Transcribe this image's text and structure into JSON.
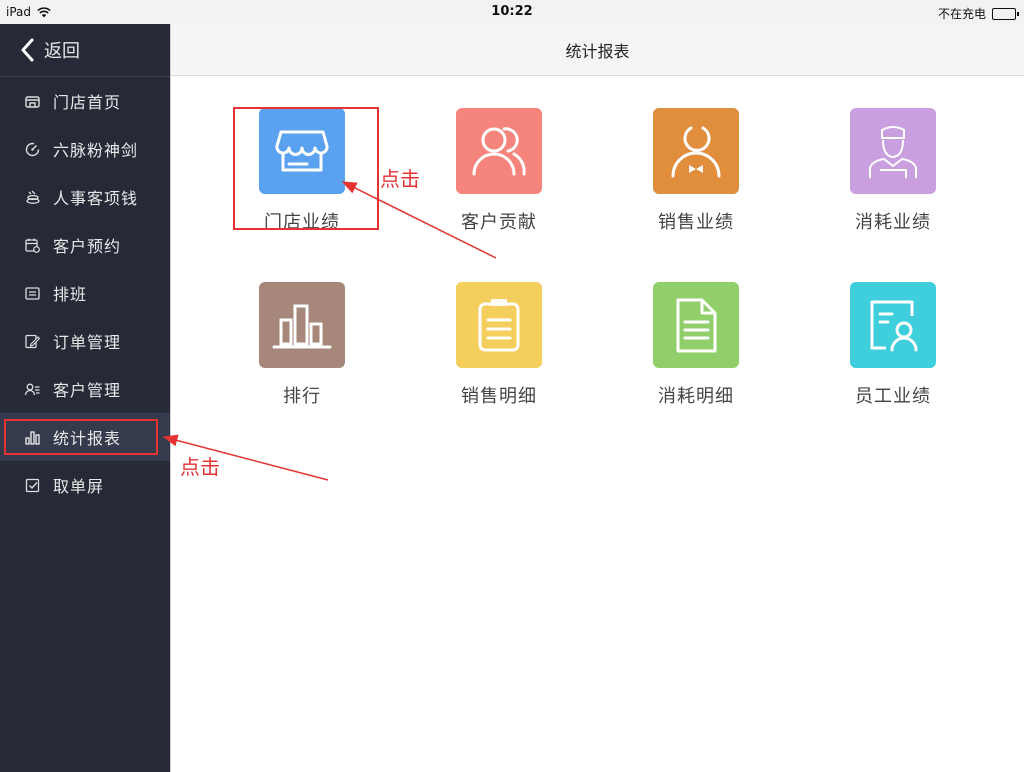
{
  "statusbar": {
    "device": "iPad",
    "time": "10:22",
    "battery": "不在充电"
  },
  "sidebar": {
    "back_label": "返回",
    "items": [
      {
        "label": "门店首页",
        "icon": "store-icon"
      },
      {
        "label": "六脉粉神剑",
        "icon": "gauge-icon"
      },
      {
        "label": "人事客项钱",
        "icon": "coins-icon"
      },
      {
        "label": "客户预约",
        "icon": "calendar-icon"
      },
      {
        "label": "排班",
        "icon": "schedule-icon"
      },
      {
        "label": "订单管理",
        "icon": "order-edit-icon"
      },
      {
        "label": "客户管理",
        "icon": "customer-list-icon"
      },
      {
        "label": "统计报表",
        "icon": "bar-chart-icon",
        "active": true
      },
      {
        "label": "取单屏",
        "icon": "checkbox-icon"
      }
    ]
  },
  "header": {
    "title": "统计报表"
  },
  "tiles": [
    {
      "label": "门店业绩",
      "color": "#5aa2f0",
      "icon": "storefront-icon"
    },
    {
      "label": "客户贡献",
      "color": "#f5857c",
      "icon": "users-icon"
    },
    {
      "label": "销售业绩",
      "color": "#e08e3c",
      "icon": "waiter-icon"
    },
    {
      "label": "消耗业绩",
      "color": "#c99fe0",
      "icon": "chef-icon"
    },
    {
      "label": "排行",
      "color": "#a6877a",
      "icon": "ranking-bars-icon"
    },
    {
      "label": "销售明细",
      "color": "#f5cf5e",
      "icon": "clipboard-icon"
    },
    {
      "label": "消耗明细",
      "color": "#90cf6a",
      "icon": "document-icon"
    },
    {
      "label": "员工业绩",
      "color": "#3fcfdc",
      "icon": "employee-card-icon"
    }
  ],
  "annotations": {
    "tile_click": "点击",
    "sidebar_click": "点击",
    "color": "#e53333"
  }
}
